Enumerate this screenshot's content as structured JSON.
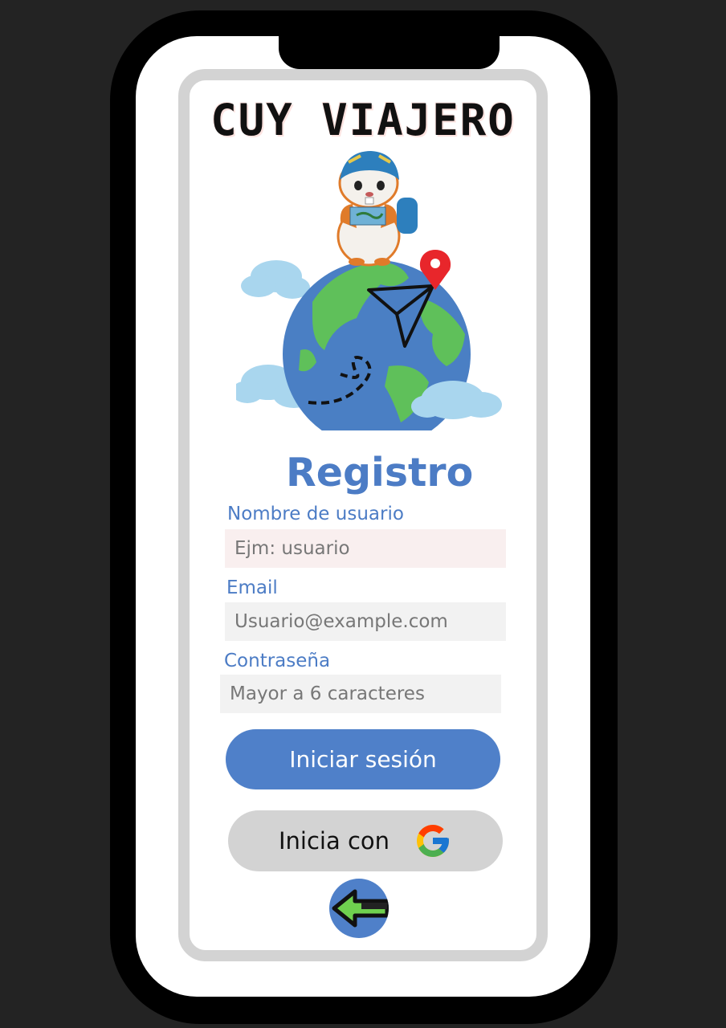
{
  "app": {
    "title": "CUY VIAJERO"
  },
  "form": {
    "heading": "Registro",
    "username": {
      "label": "Nombre de usuario",
      "placeholder": "Ejm: usuario",
      "background": "#f9efef"
    },
    "email": {
      "label": "Email",
      "placeholder": "Usuario@example.com",
      "background": "#f2f2f2"
    },
    "password": {
      "label": "Contraseña",
      "placeholder": "Mayor a 6 caracteres",
      "background": "#f2f2f2"
    },
    "submit_label": "Iniciar sesión",
    "google_label": "Inicia con"
  },
  "icons": {
    "mascot": "guinea-pig-icon",
    "globe": "globe-icon",
    "location": "location-pin-icon",
    "plane": "paper-plane-icon",
    "google": "google-icon",
    "back": "arrow-left-icon"
  },
  "colors": {
    "accent": "#4f80c9",
    "label": "#4c7cc5",
    "frame": "#d3d3d3",
    "secondary_button": "#d3d3d3"
  }
}
